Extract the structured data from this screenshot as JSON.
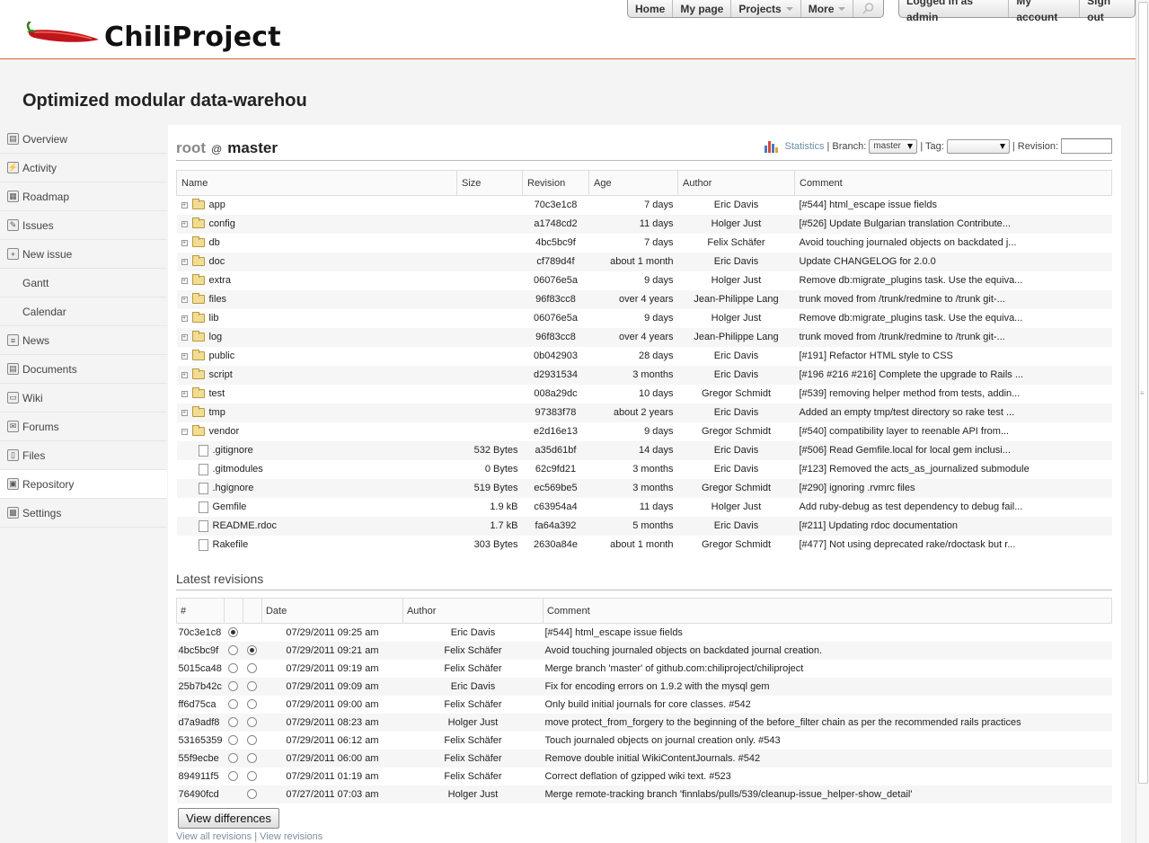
{
  "app": {
    "logo_text": "ChiliProject"
  },
  "topnav": {
    "left": [
      {
        "label": "Home",
        "dropdown": false
      },
      {
        "label": "My page",
        "dropdown": false
      },
      {
        "label": "Projects",
        "dropdown": true
      },
      {
        "label": "More",
        "dropdown": true
      }
    ],
    "right": [
      {
        "label": "Logged in as admin"
      },
      {
        "label": "My account"
      },
      {
        "label": "Sign out"
      }
    ]
  },
  "project": {
    "title": "Optimized modular data-warehou"
  },
  "sidebar": {
    "items": [
      {
        "label": "Overview",
        "icon": "overview-icon",
        "glyph": "▤"
      },
      {
        "label": "Activity",
        "icon": "activity-icon",
        "glyph": "⚡"
      },
      {
        "label": "Roadmap",
        "icon": "roadmap-icon",
        "glyph": "▦"
      },
      {
        "label": "Issues",
        "icon": "issues-icon",
        "glyph": "✎"
      },
      {
        "label": "New issue",
        "icon": "new-issue-icon",
        "glyph": "+"
      },
      {
        "label": "Gantt",
        "icon": ""
      },
      {
        "label": "Calendar",
        "icon": ""
      },
      {
        "label": "News",
        "icon": "news-icon",
        "glyph": "≡"
      },
      {
        "label": "Documents",
        "icon": "documents-icon",
        "glyph": "▤"
      },
      {
        "label": "Wiki",
        "icon": "wiki-icon",
        "glyph": "▭"
      },
      {
        "label": "Forums",
        "icon": "forums-icon",
        "glyph": "✉"
      },
      {
        "label": "Files",
        "icon": "files-icon",
        "glyph": "▯"
      },
      {
        "label": "Repository",
        "icon": "repository-icon",
        "glyph": "▣"
      },
      {
        "label": "Settings",
        "icon": "settings-icon",
        "glyph": "▩"
      }
    ],
    "active_index": 12
  },
  "repo": {
    "path_root": "root",
    "path_at": "@",
    "branch_name": "master",
    "stats_label": "Statistics",
    "branch_label": "| Branch:",
    "branch_value": "master",
    "tag_label": "| Tag:",
    "tag_value": "",
    "revision_label": "| Revision:",
    "revision_value": ""
  },
  "entries": {
    "headers": [
      "Name",
      "Size",
      "Revision",
      "Age",
      "Author",
      "Comment"
    ],
    "rows": [
      {
        "type": "dir",
        "expander": "+",
        "name": "app",
        "size": "",
        "rev": "70c3e1c8",
        "age": "7 days",
        "author": "Eric Davis",
        "comment": "[#544] html_escape issue fields"
      },
      {
        "type": "dir",
        "expander": "+",
        "name": "config",
        "size": "",
        "rev": "a1748cd2",
        "age": "11 days",
        "author": "Holger Just",
        "comment": "[#526] Update Bulgarian translation Contribute..."
      },
      {
        "type": "dir",
        "expander": "+",
        "name": "db",
        "size": "",
        "rev": "4bc5bc9f",
        "age": "7 days",
        "author": "Felix Schäfer",
        "comment": "Avoid touching journaled objects on backdated j..."
      },
      {
        "type": "dir",
        "expander": "+",
        "name": "doc",
        "size": "",
        "rev": "cf789d4f",
        "age": "about 1 month",
        "author": "Eric Davis",
        "comment": "Update CHANGELOG for 2.0.0"
      },
      {
        "type": "dir",
        "expander": "+",
        "name": "extra",
        "size": "",
        "rev": "06076e5a",
        "age": "9 days",
        "author": "Holger Just",
        "comment": "Remove db:migrate_plugins task. Use the equiva..."
      },
      {
        "type": "dir",
        "expander": "+",
        "name": "files",
        "size": "",
        "rev": "96f83cc8",
        "age": "over 4 years",
        "author": "Jean-Philippe Lang",
        "comment": "trunk moved from /trunk/redmine to /trunk git-..."
      },
      {
        "type": "dir",
        "expander": "+",
        "name": "lib",
        "size": "",
        "rev": "06076e5a",
        "age": "9 days",
        "author": "Holger Just",
        "comment": "Remove db:migrate_plugins task. Use the equiva..."
      },
      {
        "type": "dir",
        "expander": "+",
        "name": "log",
        "size": "",
        "rev": "96f83cc8",
        "age": "over 4 years",
        "author": "Jean-Philippe Lang",
        "comment": "trunk moved from /trunk/redmine to /trunk git-..."
      },
      {
        "type": "dir",
        "expander": "+",
        "name": "public",
        "size": "",
        "rev": "0b042903",
        "age": "28 days",
        "author": "Eric Davis",
        "comment": "[#191] Refactor HTML style to CSS"
      },
      {
        "type": "dir",
        "expander": "+",
        "name": "script",
        "size": "",
        "rev": "d2931534",
        "age": "3 months",
        "author": "Eric Davis",
        "comment": "[#196 #216 #216] Complete the upgrade to Rails ..."
      },
      {
        "type": "dir",
        "expander": "+",
        "name": "test",
        "size": "",
        "rev": "008a29dc",
        "age": "10 days",
        "author": "Gregor Schmidt",
        "comment": "[#539] removing helper method from tests, addin..."
      },
      {
        "type": "dir",
        "expander": "+",
        "name": "tmp",
        "size": "",
        "rev": "97383f78",
        "age": "about 2 years",
        "author": "Eric Davis",
        "comment": "Added an empty tmp/test directory so rake test ..."
      },
      {
        "type": "dir",
        "expander": "−",
        "name": "vendor",
        "size": "",
        "rev": "e2d16e13",
        "age": "9 days",
        "author": "Gregor Schmidt",
        "comment": "[#540] compatibility layer to reenable API from..."
      },
      {
        "type": "file",
        "expander": "",
        "name": ".gitignore",
        "size": "532 Bytes",
        "rev": "a35d61bf",
        "age": "14 days",
        "author": "Eric Davis",
        "comment": "[#506] Read Gemfile.local for local gem inclusi..."
      },
      {
        "type": "file",
        "expander": "",
        "name": ".gitmodules",
        "size": "0 Bytes",
        "rev": "62c9fd21",
        "age": "3 months",
        "author": "Eric Davis",
        "comment": "[#123] Removed the acts_as_journalized submodule"
      },
      {
        "type": "file",
        "expander": "",
        "name": ".hgignore",
        "size": "519 Bytes",
        "rev": "ec569be5",
        "age": "3 months",
        "author": "Gregor Schmidt",
        "comment": "[#290] ignoring .rvmrc files"
      },
      {
        "type": "file",
        "expander": "",
        "name": "Gemfile",
        "size": "1.9 kB",
        "rev": "c63954a4",
        "age": "11 days",
        "author": "Holger Just",
        "comment": "Add ruby-debug as test dependency to debug fail..."
      },
      {
        "type": "file",
        "expander": "",
        "name": "README.rdoc",
        "size": "1.7 kB",
        "rev": "fa64a392",
        "age": "5 months",
        "author": "Eric Davis",
        "comment": "[#211] Updating rdoc documentation"
      },
      {
        "type": "file",
        "expander": "",
        "name": "Rakefile",
        "size": "303 Bytes",
        "rev": "2630a84e",
        "age": "about 1 month",
        "author": "Gregor Schmidt",
        "comment": "[#477] Not using deprecated rake/rdoctask but r..."
      }
    ]
  },
  "latest": {
    "heading": "Latest revisions",
    "headers": [
      "#",
      "",
      "",
      "Date",
      "Author",
      "Comment"
    ],
    "rows": [
      {
        "rev": "70c3e1c8",
        "r1": "on",
        "r2": "",
        "date": "07/29/2011 09:25 am",
        "author": "Eric Davis",
        "comment": "[#544] html_escape issue fields"
      },
      {
        "rev": "4bc5bc9f",
        "r1": "off",
        "r2": "on",
        "date": "07/29/2011 09:21 am",
        "author": "Felix Schäfer",
        "comment": "Avoid touching journaled objects on backdated journal creation."
      },
      {
        "rev": "5015ca48",
        "r1": "off",
        "r2": "off",
        "date": "07/29/2011 09:19 am",
        "author": "Felix Schäfer",
        "comment": "Merge branch 'master' of github.com:chiliproject/chiliproject"
      },
      {
        "rev": "25b7b42c",
        "r1": "off",
        "r2": "off",
        "date": "07/29/2011 09:09 am",
        "author": "Eric Davis",
        "comment": "Fix for encoding errors on 1.9.2 with the mysql gem"
      },
      {
        "rev": "ff6d75ca",
        "r1": "off",
        "r2": "off",
        "date": "07/29/2011 09:00 am",
        "author": "Felix Schäfer",
        "comment": "Only build initial journals for core classes. #542"
      },
      {
        "rev": "d7a9adf8",
        "r1": "off",
        "r2": "off",
        "date": "07/29/2011 08:23 am",
        "author": "Holger Just",
        "comment": "move protect_from_forgery to the beginning of the before_filter chain as per the recommended rails practices"
      },
      {
        "rev": "53165359",
        "r1": "off",
        "r2": "off",
        "date": "07/29/2011 06:12 am",
        "author": "Felix Schäfer",
        "comment": "Touch journaled objects on journal creation only. #543"
      },
      {
        "rev": "55f9ecbe",
        "r1": "off",
        "r2": "off",
        "date": "07/29/2011 06:00 am",
        "author": "Felix Schäfer",
        "comment": "Remove double initial WikiContentJournals. #542"
      },
      {
        "rev": "894911f5",
        "r1": "off",
        "r2": "off",
        "date": "07/29/2011 01:19 am",
        "author": "Felix Schäfer",
        "comment": "Correct deflation of gzipped wiki text. #523"
      },
      {
        "rev": "76490fcd",
        "r1": "",
        "r2": "off",
        "date": "07/27/2011 07:03 am",
        "author": "Holger Just",
        "comment": "Merge remote-tracking branch 'finnlabs/pulls/539/cleanup-issue_helper-show_detail'"
      }
    ],
    "view_diff_label": "View differences",
    "view_all_label": "View all revisions",
    "separator": "|",
    "view_revisions_label": "View revisions"
  }
}
